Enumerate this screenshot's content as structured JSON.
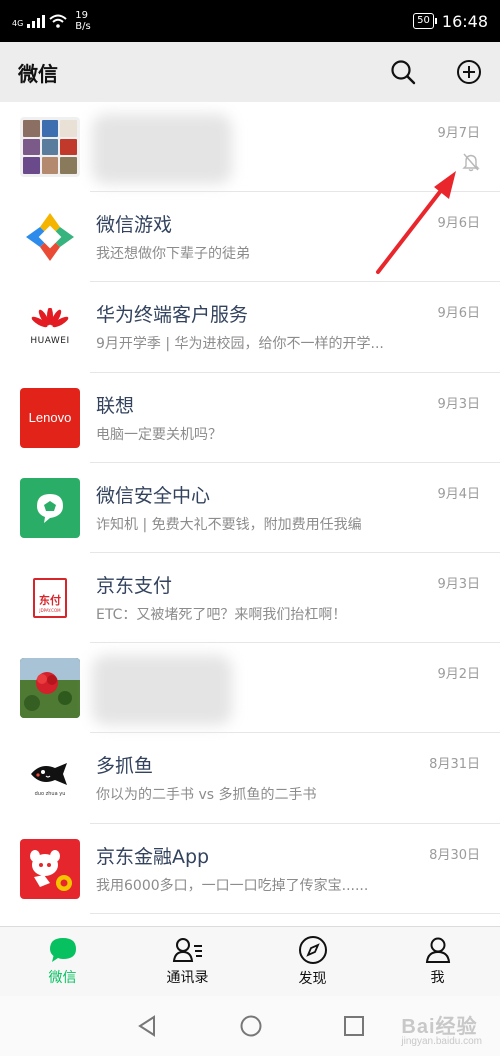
{
  "status_bar": {
    "network": "4G",
    "speed_value": "19",
    "speed_unit": "B/s",
    "battery": "50",
    "time": "16:48"
  },
  "header": {
    "title": "微信",
    "search_icon": "search-icon",
    "add_icon": "plus-circle-icon"
  },
  "chats": [
    {
      "name": "",
      "preview": "",
      "time": "9月7日",
      "muted": true,
      "blurred": true
    },
    {
      "name": "微信游戏",
      "preview": "我还想做你下辈子的徒弟",
      "time": "9月6日"
    },
    {
      "name": "华为终端客户服务",
      "preview": "9月开学季 | 华为进校园，给你不一样的开学...",
      "time": "9月6日",
      "avatar_text": "HUAWEI"
    },
    {
      "name": "联想",
      "preview": "电脑一定要关机吗？",
      "time": "9月3日",
      "avatar_text": "Lenovo"
    },
    {
      "name": "微信安全中心",
      "preview": "诈知机 | 免费大礼不要钱，附加费用任我编",
      "time": "9月4日"
    },
    {
      "name": "京东支付",
      "preview": "ETC：又被堵死了吧？来啊我们抬杠啊！",
      "time": "9月3日",
      "avatar_text": "东付",
      "avatar_subtext": "JDPAY.COM"
    },
    {
      "name": "",
      "preview": "",
      "time": "9月2日",
      "blurred": true
    },
    {
      "name": "多抓鱼",
      "preview": "你以为的二手书 vs 多抓鱼的二手书",
      "time": "8月31日",
      "avatar_text": "duo zhua yu"
    },
    {
      "name": "京东金融App",
      "preview": "我用6000多口，一口一口吃掉了传家宝......",
      "time": "8月30日"
    }
  ],
  "tabs": [
    {
      "label": "微信",
      "icon": "chat-bubble-icon",
      "active": true
    },
    {
      "label": "通讯录",
      "icon": "contacts-icon"
    },
    {
      "label": "发现",
      "icon": "compass-icon"
    },
    {
      "label": "我",
      "icon": "person-icon"
    }
  ],
  "watermark": {
    "main": "Bai经验",
    "sub": "jingyan.baidu.com"
  },
  "colors": {
    "accent_green": "#07c160",
    "arrow_red": "#e8262b",
    "name_blue": "#33435e"
  }
}
